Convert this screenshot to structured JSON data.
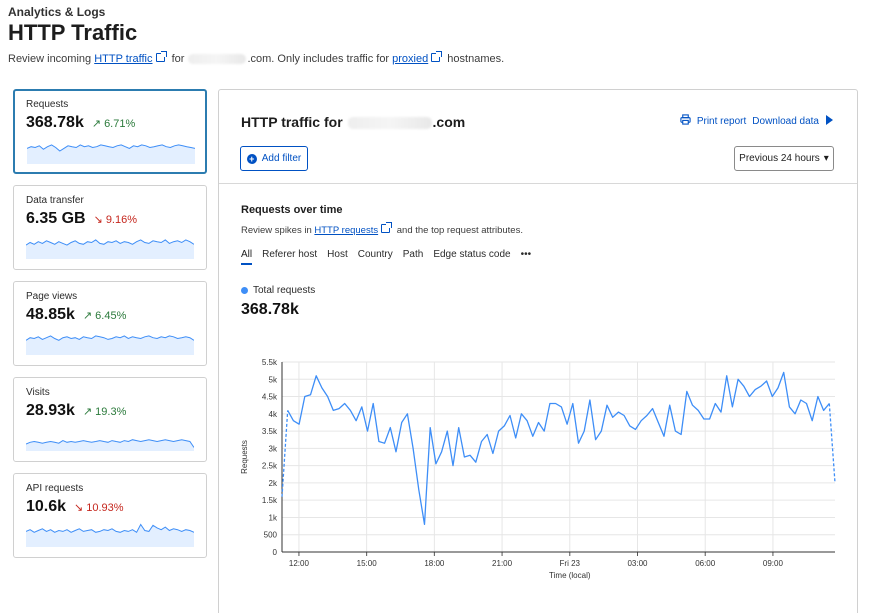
{
  "header": {
    "breadcrumb": "Analytics & Logs",
    "title": "HTTP Traffic",
    "subtitle_pre": "Review incoming",
    "subtitle_link1": "HTTP traffic",
    "subtitle_for": "for",
    "subtitle_mid": ".com. Only includes traffic for",
    "subtitle_link2": "proxied",
    "subtitle_post": "hostnames."
  },
  "metrics": [
    {
      "label": "Requests",
      "value": "368.78k",
      "change": "6.71%",
      "direction": "up"
    },
    {
      "label": "Data transfer",
      "value": "6.35 GB",
      "change": "9.16%",
      "direction": "down"
    },
    {
      "label": "Page views",
      "value": "48.85k",
      "change": "6.45%",
      "direction": "up"
    },
    {
      "label": "Visits",
      "value": "28.93k",
      "change": "19.3%",
      "direction": "up"
    },
    {
      "label": "API requests",
      "value": "10.6k",
      "change": "10.93%",
      "direction": "down"
    }
  ],
  "panel": {
    "title_pre": "HTTP traffic for",
    "title_post": ".com",
    "print_report": "Print report",
    "download_data": "Download data",
    "add_filter": "Add filter",
    "time_range": "Previous 24 hours",
    "section_title": "Requests over time",
    "section_desc_pre": "Review spikes in",
    "section_desc_link": "HTTP requests",
    "section_desc_post": "and the top request attributes.",
    "tabs": [
      "All",
      "Referer host",
      "Host",
      "Country",
      "Path",
      "Edge status code"
    ],
    "more": "•••",
    "legend": "Total requests",
    "total": "368.78k"
  },
  "icons": {
    "print": "printer-icon",
    "download": "play-triangle-icon",
    "add_filter": "plus-circle-icon",
    "external_link": "external-link-icon",
    "arrow_up": "arrow-up-right-icon",
    "arrow_down": "arrow-down-right-icon",
    "dropdown": "caret-down-icon"
  },
  "colors": {
    "accent": "#0051c3",
    "series": "#3e8ef7",
    "up": "#2b7a3b",
    "down": "#c5271e",
    "active_border": "#2c7cb0"
  },
  "chart_data": {
    "type": "line",
    "ylabel": "Requests",
    "xlabel": "Time (local)",
    "ylim": [
      0,
      5500
    ],
    "yticks": [
      "0",
      "500",
      "1k",
      "1.5k",
      "2k",
      "2.5k",
      "3k",
      "3.5k",
      "4k",
      "4.5k",
      "5k",
      "5.5k"
    ],
    "xticks": [
      "12:00",
      "15:00",
      "18:00",
      "21:00",
      "Fri 23",
      "03:00",
      "06:00",
      "09:00"
    ],
    "x_start_hours_offset": -0.75,
    "x_end_hours_offset": 23.75,
    "grid": true,
    "series": [
      {
        "name": "Total requests",
        "values": [
          1600,
          4100,
          3800,
          3700,
          4500,
          4550,
          5100,
          4750,
          4500,
          4100,
          4150,
          4300,
          4100,
          3800,
          4200,
          3500,
          4300,
          3200,
          3150,
          3600,
          2900,
          3750,
          4000,
          3000,
          1800,
          800,
          3600,
          2550,
          2900,
          3500,
          2500,
          3600,
          2750,
          2800,
          2600,
          3200,
          3400,
          2850,
          3500,
          3650,
          3950,
          3300,
          4000,
          3800,
          3350,
          3750,
          3500,
          4300,
          4300,
          4200,
          3700,
          4300,
          3150,
          3500,
          4400,
          3250,
          3500,
          4250,
          3900,
          4050,
          3950,
          3650,
          3550,
          3800,
          3950,
          4150,
          3750,
          3350,
          4250,
          3500,
          3400,
          4650,
          4250,
          4100,
          3850,
          3850,
          4300,
          4050,
          5100,
          4200,
          5000,
          4800,
          4500,
          4700,
          4800,
          4950,
          4500,
          4750,
          5200,
          4200,
          4000,
          4400,
          4300,
          3800,
          4500,
          4100,
          4300,
          2000
        ]
      }
    ]
  },
  "sparklines": [
    [
      18,
      20,
      19,
      21,
      17,
      20,
      22,
      19,
      15,
      18,
      21,
      20,
      19,
      22,
      20,
      21,
      19,
      20,
      22,
      21,
      20,
      19,
      21,
      22,
      20,
      18,
      21,
      20,
      22,
      21,
      19,
      20,
      21,
      22,
      20,
      19,
      21,
      22,
      21,
      20,
      19,
      18
    ],
    [
      16,
      19,
      17,
      20,
      18,
      21,
      19,
      17,
      20,
      18,
      16,
      19,
      21,
      18,
      17,
      20,
      19,
      22,
      18,
      17,
      20,
      19,
      21,
      18,
      20,
      19,
      17,
      20,
      22,
      19,
      18,
      21,
      20,
      19,
      22,
      18,
      20,
      21,
      19,
      22,
      20,
      17
    ],
    [
      17,
      20,
      19,
      21,
      18,
      20,
      22,
      19,
      17,
      20,
      21,
      19,
      20,
      18,
      21,
      20,
      19,
      22,
      21,
      20,
      18,
      19,
      21,
      20,
      22,
      19,
      21,
      20,
      19,
      21,
      22,
      20,
      19,
      21,
      20,
      22,
      21,
      19,
      20,
      21,
      20,
      17
    ],
    [
      8,
      10,
      11,
      10,
      9,
      10,
      11,
      10,
      9,
      12,
      10,
      11,
      10,
      11,
      12,
      11,
      10,
      11,
      12,
      11,
      10,
      12,
      11,
      10,
      12,
      11,
      13,
      12,
      11,
      12,
      13,
      12,
      11,
      12,
      13,
      12,
      11,
      12,
      13,
      12,
      11,
      4
    ],
    [
      18,
      20,
      17,
      19,
      21,
      18,
      20,
      17,
      19,
      18,
      20,
      17,
      19,
      21,
      18,
      19,
      20,
      17,
      18,
      20,
      19,
      21,
      18,
      17,
      19,
      18,
      20,
      17,
      26,
      19,
      18,
      25,
      22,
      20,
      23,
      19,
      21,
      20,
      18,
      20,
      19,
      17
    ]
  ]
}
